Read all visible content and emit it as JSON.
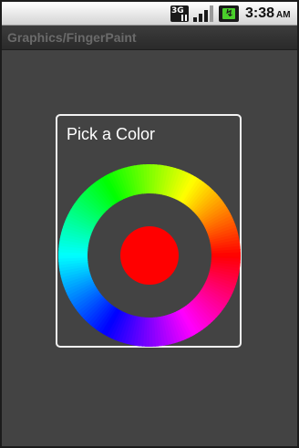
{
  "status_bar": {
    "network_label": "3G",
    "time": "3:38",
    "am_pm": "AM",
    "icons": [
      "3g-icon",
      "signal-icon",
      "battery-charging-icon"
    ],
    "signal_level_fraction": 0.75
  },
  "app_bar": {
    "title": "Graphics/FingerPaint"
  },
  "dialog": {
    "title": "Pick a Color",
    "selected_color": "#ff0000",
    "wheel_colors": [
      "#ff0000",
      "#ff00ff",
      "#0000ff",
      "#00ffff",
      "#00ff00",
      "#ffff00",
      "#ff0000"
    ]
  },
  "colors": {
    "screen_background": "#434343",
    "dialog_border": "#f2f2f2",
    "title_text": "#6a6a6a"
  }
}
